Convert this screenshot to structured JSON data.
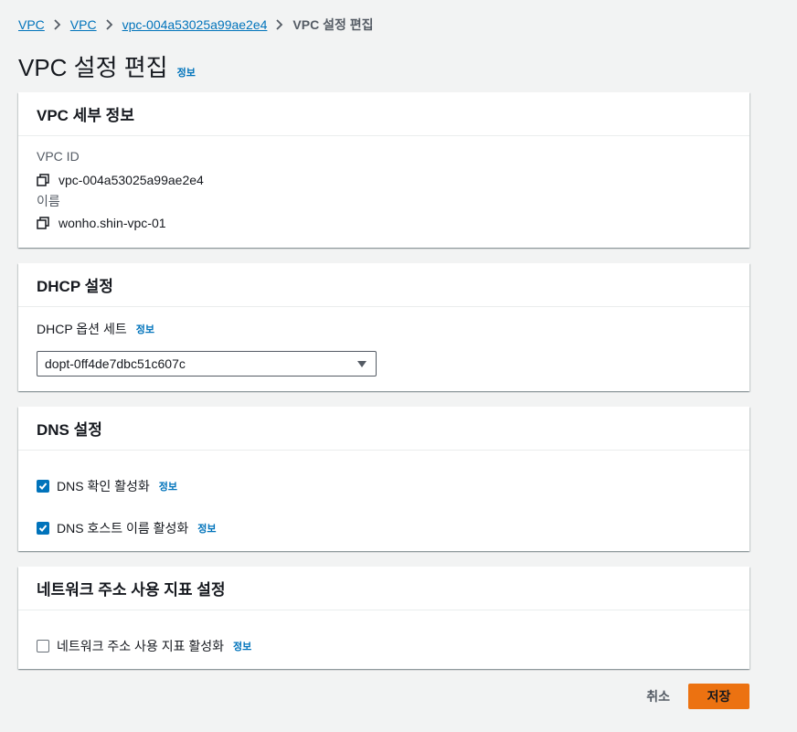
{
  "breadcrumb": {
    "items": [
      "VPC",
      "VPC",
      "vpc-004a53025a99ae2e4"
    ],
    "current": "VPC 설정 편집"
  },
  "header": {
    "title": "VPC 설정 편집",
    "info": "정보"
  },
  "vpc_details": {
    "title": "VPC 세부 정보",
    "vpc_id_label": "VPC ID",
    "vpc_id_value": "vpc-004a53025a99ae2e4",
    "name_label": "이름",
    "name_value": "wonho.shin-vpc-01"
  },
  "dhcp": {
    "title": "DHCP 설정",
    "option_set_label": "DHCP 옵션 세트",
    "info": "정보",
    "selected_value": "dopt-0ff4de7dbc51c607c"
  },
  "dns": {
    "title": "DNS 설정",
    "resolution_label": "DNS 확인 활성화",
    "resolution_checked": true,
    "hostnames_label": "DNS 호스트 이름 활성화",
    "hostnames_checked": true,
    "info": "정보"
  },
  "network_metrics": {
    "title": "네트워크 주소 사용 지표 설정",
    "enable_label": "네트워크 주소 사용 지표 활성화",
    "enable_checked": false,
    "info": "정보"
  },
  "actions": {
    "cancel_label": "취소",
    "save_label": "저장"
  },
  "colors": {
    "link": "#0073bb",
    "primary_button": "#ec7211",
    "background": "#f2f3f3"
  }
}
